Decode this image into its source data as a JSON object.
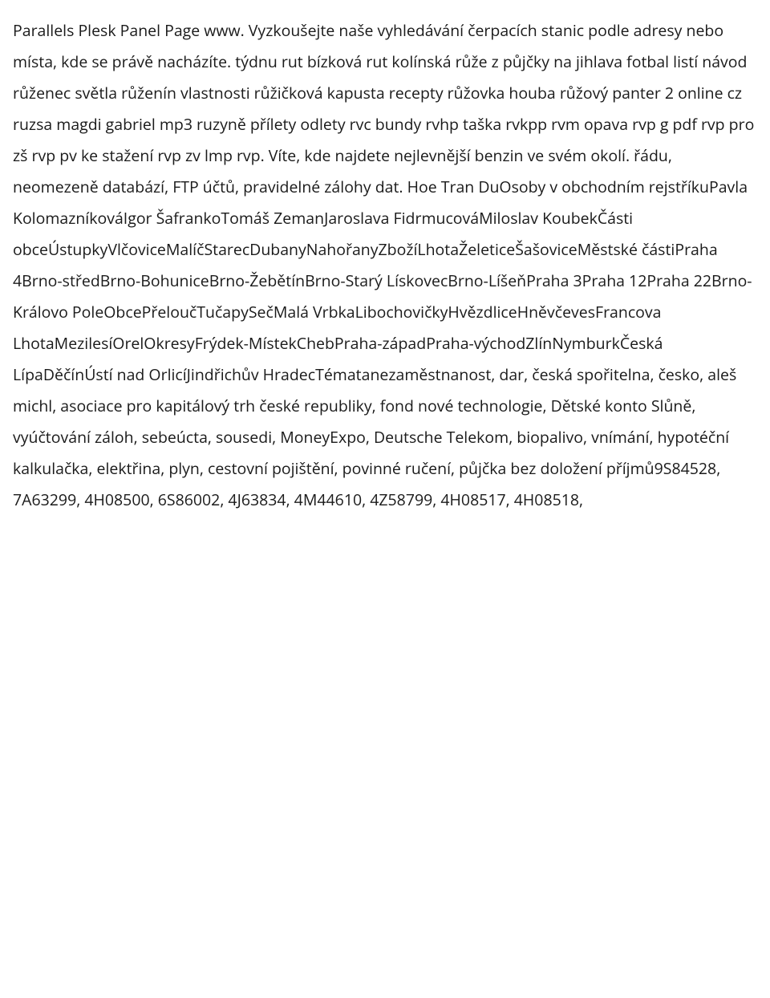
{
  "body_text": "Parallels Plesk Panel Page www. Vyzkoušejte naše vyhledávání čerpacích stanic podle adresy nebo místa, kde se právě nacházíte. týdnu rut bízková rut kolínská růže z půjčky na jihlava fotbal listí návod růženec světla růženín vlastnosti růžičková kapusta recepty růžovka houba růžový panter 2 online cz ruzsa magdi gabriel mp3 ruzyně přílety odlety rvc bundy rvhp taška rvkpp rvm opava rvp g pdf rvp pro zš rvp pv ke stažení rvp zv lmp rvp. Víte, kde najdete nejlevnější benzin ve svém okolí. řádu, neomezeně databází, FTP účtů, pravidelné zálohy dat. Hoe Tran DuOsoby v obchodním rejstříkuPavla KolomazníkováIgor ŠafrankoTomáš ZemanJaroslava FidrmucováMiloslav KoubekČásti obceÚstupkyVlčoviceMalíčStarecDubanyNahořanyZbožíLhotaŽeleticeŠašoviceMěstské částiPraha 4Brno-středBrno-BohuniceBrno-ŽebětínBrno-Starý LískovecBrno-LíšeňPraha 3Praha 12Praha 22Brno-Královo PoleObcePřeloučTučapySečMalá VrbkaLibochovičkyHvězdliceHněvčevesFrancova LhotaMezilesíOrelOkresyFrýdek-MístekChebPraha-západPraha-východZlínNymburkČeská LípaDěčínÚstí nad OrlicíJindřichův HradecTématanezaměstnanost, dar, česká spořitelna, česko, aleš michl, asociace pro kapitálový trh české republiky, fond nové technologie, Dětské konto Slůně, vyúčtování záloh, sebeúcta, sousedi, MoneyExpo, Deutsche Telekom, biopalivo, vnímání, hypotéční kalkulačka, elektřina, plyn, cestovní pojištění, povinné ručení, půjčka bez doložení příjmů9S84528, 7A63299, 4H08500, 6S86002, 4J63834, 4M44610, 4Z58799, 4H08517, 4H08518,"
}
